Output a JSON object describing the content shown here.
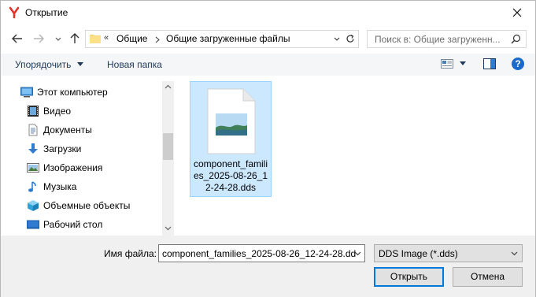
{
  "window": {
    "title": "Открытие",
    "accent": "#0078d7"
  },
  "address_bar": {
    "overflow": "«",
    "breadcrumbs": [
      "Общие",
      "Общие загруженные файлы"
    ]
  },
  "search": {
    "placeholder": "Поиск в: Общие загруженн..."
  },
  "toolbar": {
    "organize_label": "Упорядочить",
    "new_folder_label": "Новая папка",
    "help_label": "?"
  },
  "sidebar": {
    "items": [
      {
        "label": "Этот компьютер",
        "icon": "computer-icon"
      },
      {
        "label": "Видео",
        "icon": "video-icon"
      },
      {
        "label": "Документы",
        "icon": "documents-icon"
      },
      {
        "label": "Загрузки",
        "icon": "downloads-icon"
      },
      {
        "label": "Изображения",
        "icon": "pictures-icon"
      },
      {
        "label": "Музыка",
        "icon": "music-icon"
      },
      {
        "label": "Объемные объекты",
        "icon": "3d-objects-icon"
      },
      {
        "label": "Рабочий стол",
        "icon": "desktop-icon"
      }
    ]
  },
  "files": [
    {
      "name": "component_families_2025-08-26_12-24-28.dds",
      "selected": true
    }
  ],
  "footer": {
    "filename_label": "Имя файла:",
    "filename_value": "component_families_2025-08-26_12-24-28.dd",
    "filetype_value": "DDS Image (*.dds)",
    "open_label": "Открыть",
    "cancel_label": "Отмена"
  }
}
